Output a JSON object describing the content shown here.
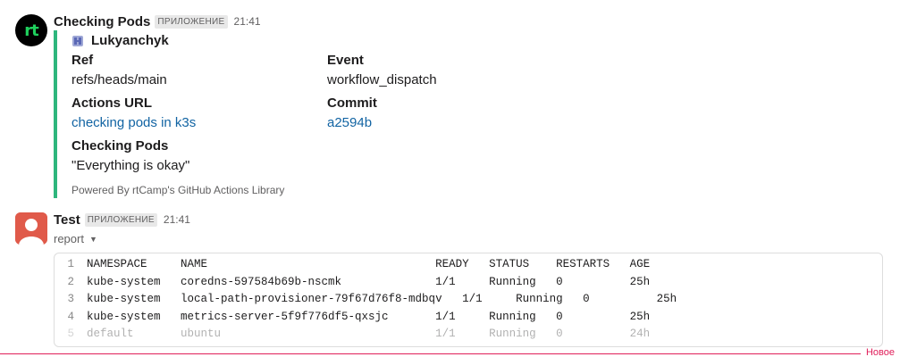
{
  "message1": {
    "sender": "Checking Pods",
    "badge": "ПРИЛОЖЕНИЕ",
    "time": "21:41",
    "avatar_text": "rt",
    "attachment": {
      "accent_color": "#2eb67d",
      "author": "Lukyanchyk",
      "fields": {
        "ref_title": "Ref",
        "ref_value": "refs/heads/main",
        "event_title": "Event",
        "event_value": "workflow_dispatch",
        "actions_title": "Actions URL",
        "actions_value": "checking pods in k3s",
        "commit_title": "Commit",
        "commit_value": "a2594b",
        "pods_title": "Checking Pods",
        "pods_value": "\"Everything is okay\""
      },
      "footer": "Powered By rtCamp's GitHub Actions Library"
    }
  },
  "message2": {
    "sender": "Test",
    "badge": "ПРИЛОЖЕНИЕ",
    "time": "21:41",
    "file_label": "report",
    "code_lines": [
      {
        "n": "1",
        "text": "NAMESPACE     NAME                                  READY   STATUS    RESTARTS   AGE"
      },
      {
        "n": "2",
        "text": "kube-system   coredns-597584b69b-nscmk              1/1     Running   0          25h"
      },
      {
        "n": "3",
        "text": "kube-system   local-path-provisioner-79f67d76f8-mdbqv   1/1     Running   0          25h"
      },
      {
        "n": "4",
        "text": "kube-system   metrics-server-5f9f776df5-qxsjc       1/1     Running   0          25h"
      },
      {
        "n": "5",
        "text": "default       ubuntu                                1/1     Running   0          24h"
      }
    ]
  },
  "new_divider_label": "Новое"
}
